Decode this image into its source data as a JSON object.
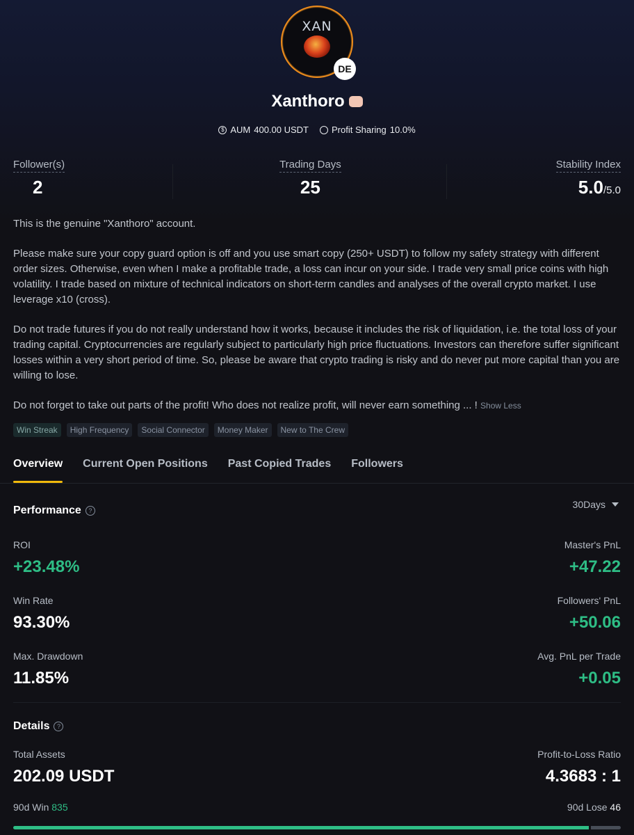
{
  "profile": {
    "avatar_text": "XAN",
    "country_code": "DE",
    "name": "Xanthoro",
    "aum_label": "AUM",
    "aum_value": "400.00 USDT",
    "profit_sharing_label": "Profit Sharing",
    "profit_sharing_value": "10.0%"
  },
  "stats": {
    "followers_label": "Follower(s)",
    "followers_value": "2",
    "trading_days_label": "Trading Days",
    "trading_days_value": "25",
    "stability_label": "Stability Index",
    "stability_value": "5.0",
    "stability_max": "/5.0"
  },
  "description": {
    "paragraphs": [
      "This is the genuine \"Xanthoro\" account.",
      "Please make sure your copy guard option is off and you use smart copy (250+ USDT) to follow my safety strategy with different order sizes. Otherwise, even when I make a profitable trade, a loss can incur on your side. I trade very small price coins with high volatility. I trade based on mixture of technical indicators on short-term candles and analyses of the overall crypto market. I use leverage x10 (cross).",
      "Do not trade futures if you do not really understand how it works, because it includes the risk of liquidation, i.e. the total loss of your trading capital. Cryptocurrencies are regularly subject to particularly high price fluctuations. Investors can therefore suffer significant losses within a very short period of time. So, please be aware that crypto trading is risky and do never put more capital than you are willing to lose.",
      "Do not forget to take out parts of the profit! Who does not realize profit, will never earn something ... !"
    ],
    "show_less": "Show Less"
  },
  "tags": [
    "Win Streak",
    "High Frequency",
    "Social Connector",
    "Money Maker",
    "New to The Crew"
  ],
  "tabs": [
    {
      "label": "Overview",
      "active": true
    },
    {
      "label": "Current Open Positions",
      "active": false
    },
    {
      "label": "Past Copied Trades",
      "active": false
    },
    {
      "label": "Followers",
      "active": false
    }
  ],
  "performance": {
    "title": "Performance",
    "period": "30Days",
    "roi_label": "ROI",
    "roi_value": "+23.48%",
    "masters_pnl_label": "Master's PnL",
    "masters_pnl_value": "+47.22",
    "win_rate_label": "Win Rate",
    "win_rate_value": "93.30%",
    "followers_pnl_label": "Followers' PnL",
    "followers_pnl_value": "+50.06",
    "max_drawdown_label": "Max. Drawdown",
    "max_drawdown_value": "11.85%",
    "avg_pnl_label": "Avg. PnL per Trade",
    "avg_pnl_value": "+0.05"
  },
  "details": {
    "title": "Details",
    "total_assets_label": "Total Assets",
    "total_assets_value": "202.09 USDT",
    "pl_ratio_label": "Profit-to-Loss Ratio",
    "pl_ratio_value": "4.3683 : 1",
    "win_label": "90d Win",
    "win_value": "835",
    "lose_label": "90d Lose",
    "lose_value": "46",
    "win_fraction": 0.9478
  },
  "colors": {
    "accent": "#f0b90b",
    "positive": "#2ebd85",
    "background": "#111116"
  }
}
